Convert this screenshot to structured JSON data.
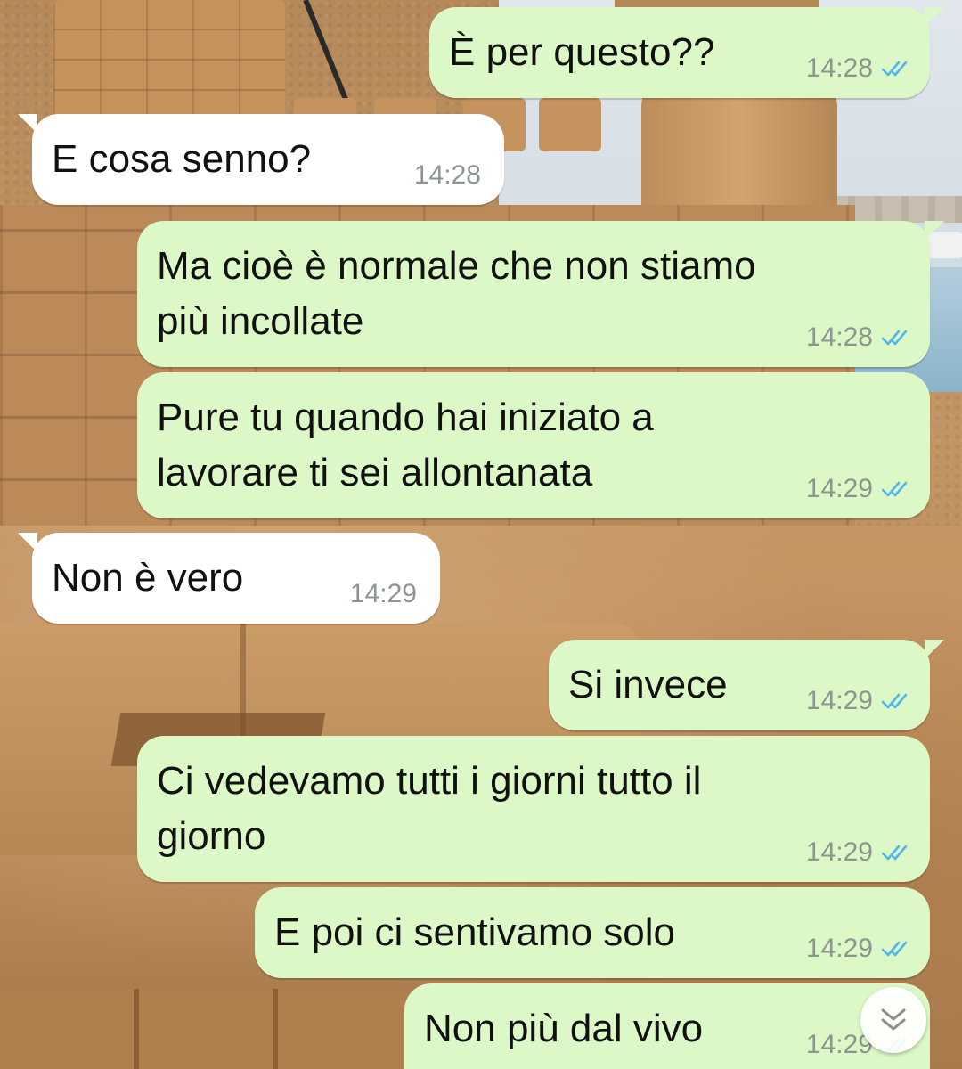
{
  "chat": {
    "messages": [
      {
        "id": "m1",
        "direction": "outgoing",
        "text": "È per questo??",
        "time": "14:28",
        "status": "read"
      },
      {
        "id": "m2",
        "direction": "incoming",
        "text": "E cosa senno?",
        "time": "14:28"
      },
      {
        "id": "m3",
        "direction": "outgoing",
        "text": "Ma cioè è normale che non stiamo\npiù incollate",
        "time": "14:28",
        "status": "read"
      },
      {
        "id": "m4",
        "direction": "outgoing",
        "text": "Pure tu quando hai iniziato a\nlavorare ti sei allontanata",
        "time": "14:29",
        "status": "read"
      },
      {
        "id": "m5",
        "direction": "incoming",
        "text": "Non è vero",
        "time": "14:29"
      },
      {
        "id": "m6",
        "direction": "outgoing",
        "text": "Si invece",
        "time": "14:29",
        "status": "read"
      },
      {
        "id": "m7",
        "direction": "outgoing",
        "text": "Ci vedevamo tutti i giorni tutto il\ngiorno",
        "time": "14:29",
        "status": "read"
      },
      {
        "id": "m8",
        "direction": "outgoing",
        "text": "E poi ci sentivamo solo",
        "time": "14:29",
        "status": "read"
      },
      {
        "id": "m9",
        "direction": "outgoing",
        "text": "Non più dal vivo",
        "time": "14:29",
        "status": "read"
      }
    ],
    "scroll_down_icon": "double-chevron-down-icon"
  },
  "colors": {
    "outgoing_bubble": "#dcf8c6",
    "incoming_bubble": "#ffffff",
    "read_ticks": "#4fb6ec",
    "timestamp": "#8c9590"
  }
}
